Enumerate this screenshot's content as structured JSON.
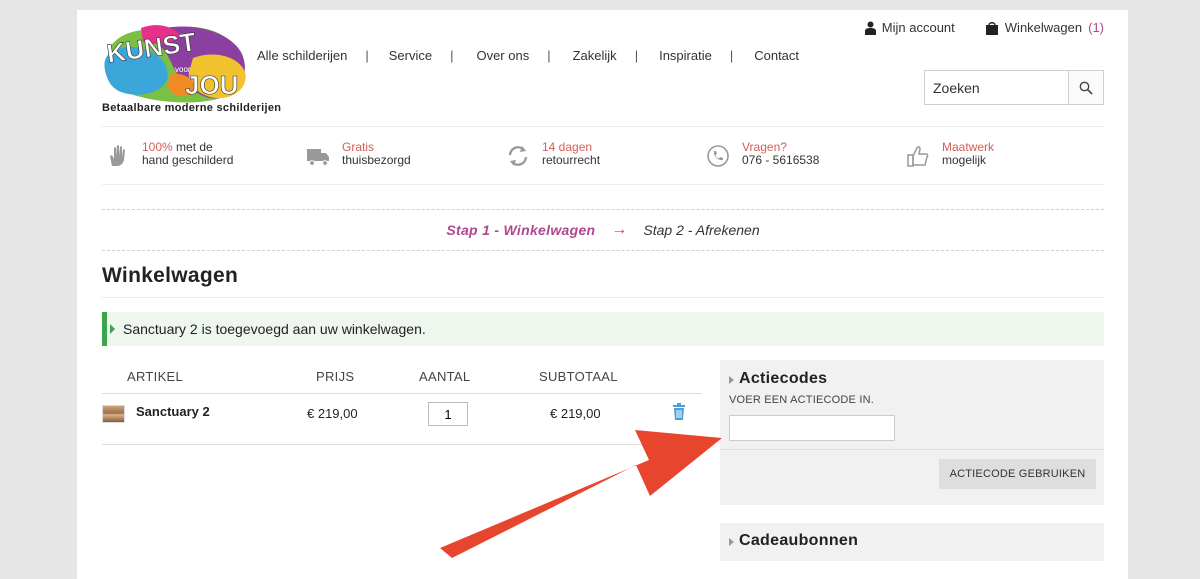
{
  "brand": {
    "logo_text_top": "KUNST",
    "logo_text_mid": "voor",
    "logo_text_bottom": "JOU",
    "tagline": "Betaalbare moderne schilderijen"
  },
  "nav": {
    "items": [
      "Alle schilderijen",
      "Service",
      "Over ons",
      "Zakelijk",
      "Inspiratie",
      "Contact"
    ],
    "separator": "|"
  },
  "account": {
    "label": "Mijn account",
    "icon": "user-icon"
  },
  "cart_link": {
    "label": "Winkelwagen",
    "count": "(1)",
    "icon": "shopping-bag-icon"
  },
  "search": {
    "placeholder": "Zoeken",
    "icon": "search-icon"
  },
  "usps": [
    {
      "highlight": "100%",
      "rest1": " met de",
      "line2": "hand geschilderd",
      "icon": "hand-icon"
    },
    {
      "highlight": "Gratis",
      "rest1": "",
      "line2": "thuisbezorgd",
      "icon": "truck-icon"
    },
    {
      "highlight": "14 dagen",
      "rest1": "",
      "line2": "retourrecht",
      "icon": "refresh-icon"
    },
    {
      "highlight": "Vragen?",
      "rest1": "",
      "line2": "076 - 5616538",
      "icon": "phone-icon"
    },
    {
      "highlight": "Maatwerk",
      "rest1": "",
      "line2": "mogelijk",
      "icon": "thumbs-up-icon"
    }
  ],
  "steps": {
    "step1": "Stap 1 - Winkelwagen",
    "arrow": "→",
    "step2": "Stap 2 - Afrekenen"
  },
  "page_title": "Winkelwagen",
  "alert": "Sanctuary 2 is toegevoegd aan uw winkelwagen.",
  "cart_table": {
    "headers": {
      "artikel": "ARTIKEL",
      "prijs": "PRIJS",
      "aantal": "AANTAL",
      "subtotaal": "SUBTOTAAL"
    },
    "rows": [
      {
        "name": "Sanctuary 2",
        "price": "€ 219,00",
        "qty": "1",
        "subtotal": "€ 219,00"
      }
    ]
  },
  "actiecodes": {
    "title": "Actiecodes",
    "label": "VOER EEN ACTIECODE IN.",
    "input_value": "",
    "button": "ACTIECODE GEBRUIKEN"
  },
  "cadeaubonnen": {
    "title": "Cadeaubonnen"
  },
  "colors": {
    "accent": "#b0478f",
    "usp_highlight": "#d65d55",
    "alert_border": "#3fa34d",
    "arrow": "#e8452f"
  }
}
